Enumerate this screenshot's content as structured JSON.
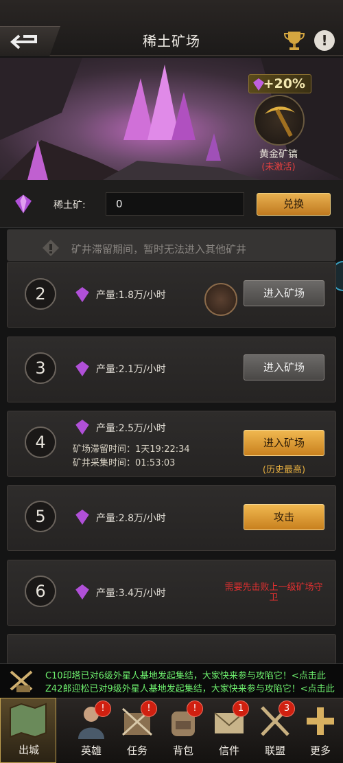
{
  "header": {
    "title": "稀土矿场"
  },
  "banner": {
    "bonus": "+20%",
    "pickaxe_name": "黄金矿镐",
    "pickaxe_status": "(未激活)"
  },
  "ore": {
    "label": "稀土矿:",
    "value": "0",
    "exchange_label": "兑换"
  },
  "warning": {
    "text": "矿井滞留期间，暂时无法进入其他矿井"
  },
  "mines": [
    {
      "num": "2",
      "production": "产量:1.8万/小时",
      "button": "进入矿场"
    },
    {
      "num": "3",
      "production": "产量:2.1万/小时",
      "button": "进入矿场"
    },
    {
      "num": "4",
      "production": "产量:2.5万/小时",
      "stay": "矿场滞留时间：1天19:22:34",
      "collect": "矿井采集时间：01:53:03",
      "button": "进入矿场",
      "note": "(历史最高)"
    },
    {
      "num": "5",
      "production": "产量:2.8万/小时",
      "button": "攻击"
    },
    {
      "num": "6",
      "production": "产量:3.4万/小时",
      "locked_text": "需要先击败上一级矿场守卫"
    }
  ],
  "ticker": {
    "line1": "C10印塔已对6级外星人基地发起集结，大家快来参与攻陷它！<点击此",
    "line2": "Z42郎迎松已对9级外星人基地发起集结，大家快来参与攻陷它！<点击此"
  },
  "nav": {
    "city": "出城",
    "items": [
      {
        "label": "英雄",
        "badge": "!"
      },
      {
        "label": "任务",
        "badge": "!"
      },
      {
        "label": "背包",
        "badge": "!"
      },
      {
        "label": "信件",
        "badge": "1"
      },
      {
        "label": "联盟",
        "badge": "3"
      },
      {
        "label": "更多",
        "badge": ""
      }
    ]
  },
  "colors": {
    "accent_gold": "#e8b050",
    "ticker_green": "#6ef06e",
    "alert_red": "#e03030"
  }
}
